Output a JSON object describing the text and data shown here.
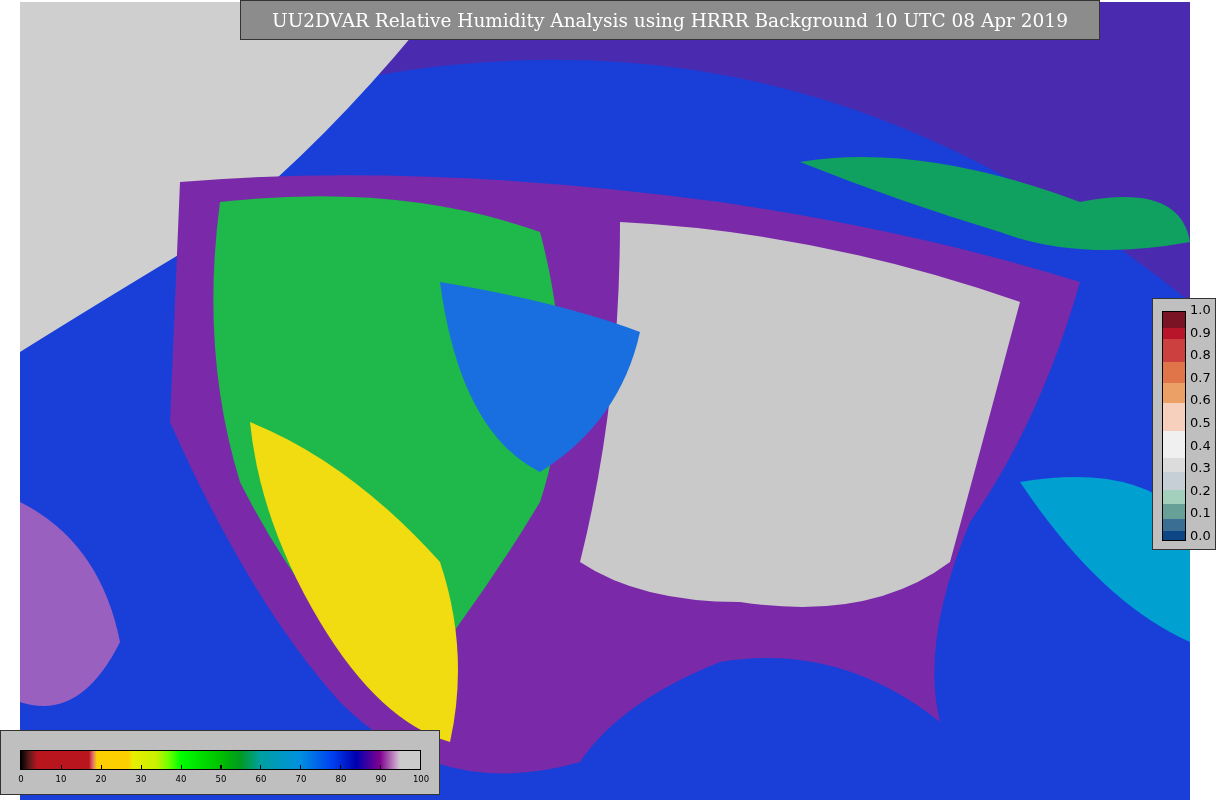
{
  "title": "UU2DVAR Relative Humidity Analysis using HRRR Background 10 UTC 08 Apr 2019",
  "humidity_colorbar": {
    "ticks": [
      "0",
      "10",
      "20",
      "30",
      "40",
      "50",
      "60",
      "70",
      "80",
      "90",
      "100"
    ]
  },
  "ratio_colorbar": {
    "ticks": [
      "1.0",
      "0.9",
      "0.8",
      "0.7",
      "0.6",
      "0.5",
      "0.4",
      "0.3",
      "0.2",
      "0.1",
      "0.0"
    ]
  }
}
